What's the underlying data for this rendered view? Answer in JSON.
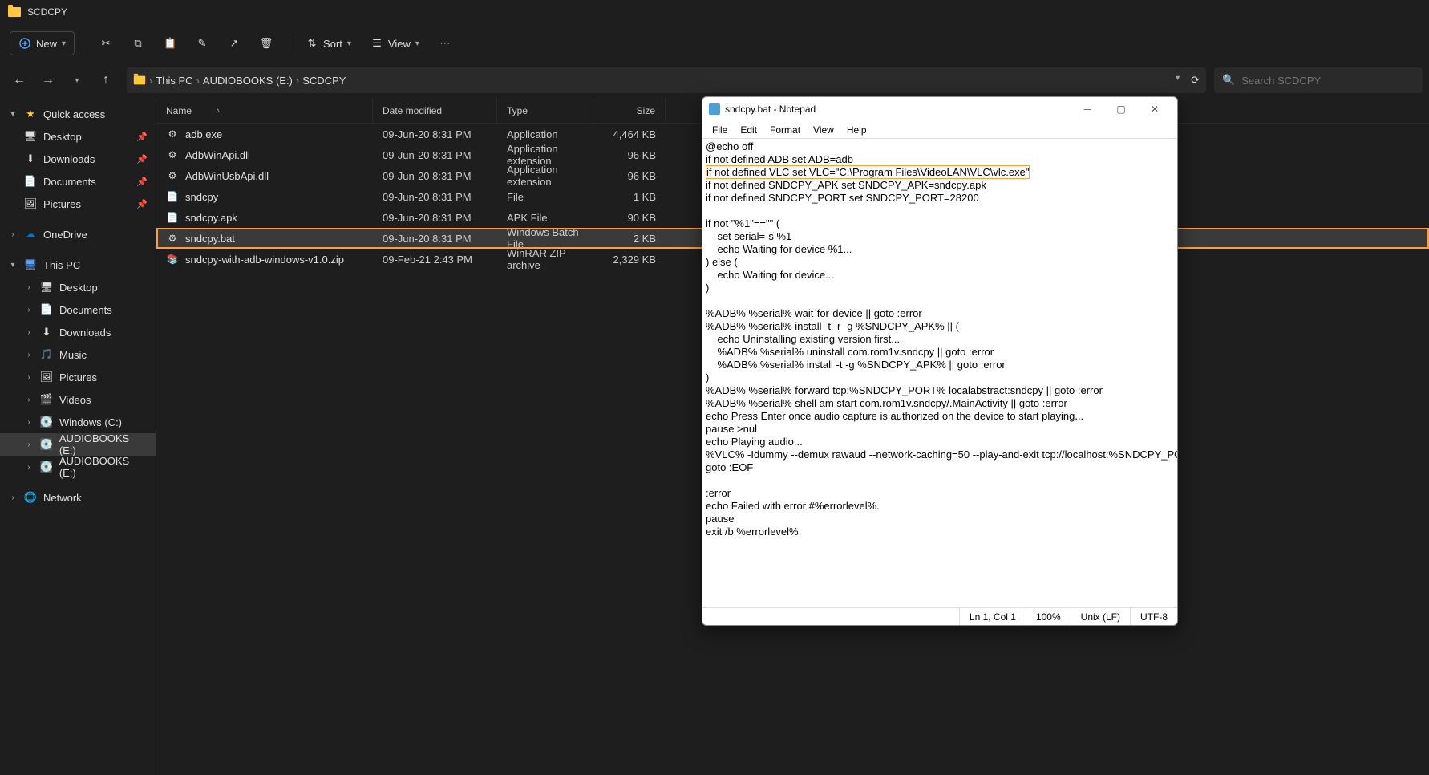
{
  "window": {
    "title": "SCDCPY"
  },
  "toolbar": {
    "new": "New",
    "sort": "Sort",
    "view": "View"
  },
  "breadcrumb": [
    "This PC",
    "AUDIOBOOKS (E:)",
    "SCDCPY"
  ],
  "search": {
    "placeholder": "Search SCDCPY"
  },
  "sidebar": {
    "quick_access": "Quick access",
    "quick_items": [
      {
        "label": "Desktop",
        "icon": "🖥"
      },
      {
        "label": "Downloads",
        "icon": "⬇"
      },
      {
        "label": "Documents",
        "icon": "📄"
      },
      {
        "label": "Pictures",
        "icon": "🖼"
      }
    ],
    "onedrive": "OneDrive",
    "this_pc": "This PC",
    "pc_items": [
      {
        "label": "Desktop",
        "icon": "🖥"
      },
      {
        "label": "Documents",
        "icon": "📄"
      },
      {
        "label": "Downloads",
        "icon": "⬇"
      },
      {
        "label": "Music",
        "icon": "🎵"
      },
      {
        "label": "Pictures",
        "icon": "🖼"
      },
      {
        "label": "Videos",
        "icon": "🎬"
      },
      {
        "label": "Windows (C:)",
        "icon": "💽"
      },
      {
        "label": "AUDIOBOOKS (E:)",
        "icon": "💽",
        "selected": true
      },
      {
        "label": "AUDIOBOOKS (E:)",
        "icon": "💽"
      }
    ],
    "network": "Network"
  },
  "columns": {
    "name": "Name",
    "date": "Date modified",
    "type": "Type",
    "size": "Size"
  },
  "files": [
    {
      "name": "adb.exe",
      "date": "09-Jun-20 8:31 PM",
      "type": "Application",
      "size": "4,464 KB",
      "icon": "⚙"
    },
    {
      "name": "AdbWinApi.dll",
      "date": "09-Jun-20 8:31 PM",
      "type": "Application extension",
      "size": "96 KB",
      "icon": "⚙"
    },
    {
      "name": "AdbWinUsbApi.dll",
      "date": "09-Jun-20 8:31 PM",
      "type": "Application extension",
      "size": "96 KB",
      "icon": "⚙"
    },
    {
      "name": "sndcpy",
      "date": "09-Jun-20 8:31 PM",
      "type": "File",
      "size": "1 KB",
      "icon": "📄"
    },
    {
      "name": "sndcpy.apk",
      "date": "09-Jun-20 8:31 PM",
      "type": "APK File",
      "size": "90 KB",
      "icon": "📄"
    },
    {
      "name": "sndcpy.bat",
      "date": "09-Jun-20 8:31 PM",
      "type": "Windows Batch File",
      "size": "2 KB",
      "icon": "⚙",
      "highlight": true,
      "selected": true
    },
    {
      "name": "sndcpy-with-adb-windows-v1.0.zip",
      "date": "09-Feb-21 2:43 PM",
      "type": "WinRAR ZIP archive",
      "size": "2,329 KB",
      "icon": "📚"
    }
  ],
  "notepad": {
    "title": "sndcpy.bat - Notepad",
    "menu": [
      "File",
      "Edit",
      "Format",
      "View",
      "Help"
    ],
    "lines_before": "@echo off\nif not defined ADB set ADB=adb",
    "highlighted_line": "if not defined VLC set VLC=\"C:\\Program Files\\VideoLAN\\VLC\\vlc.exe\"",
    "lines_after": "if not defined SNDCPY_APK set SNDCPY_APK=sndcpy.apk\nif not defined SNDCPY_PORT set SNDCPY_PORT=28200\n\nif not \"%1\"==\"\" (\n    set serial=-s %1\n    echo Waiting for device %1...\n) else (\n    echo Waiting for device...\n)\n\n%ADB% %serial% wait-for-device || goto :error\n%ADB% %serial% install -t -r -g %SNDCPY_APK% || (\n    echo Uninstalling existing version first...\n    %ADB% %serial% uninstall com.rom1v.sndcpy || goto :error\n    %ADB% %serial% install -t -g %SNDCPY_APK% || goto :error\n)\n%ADB% %serial% forward tcp:%SNDCPY_PORT% localabstract:sndcpy || goto :error\n%ADB% %serial% shell am start com.rom1v.sndcpy/.MainActivity || goto :error\necho Press Enter once audio capture is authorized on the device to start playing...\npause >nul\necho Playing audio...\n%VLC% -Idummy --demux rawaud --network-caching=50 --play-and-exit tcp://localhost:%SNDCPY_PORT%\ngoto :EOF\n\n:error\necho Failed with error #%errorlevel%.\npause\nexit /b %errorlevel%",
    "status": {
      "pos": "Ln 1, Col 1",
      "zoom": "100%",
      "eol": "Unix (LF)",
      "enc": "UTF-8"
    }
  }
}
